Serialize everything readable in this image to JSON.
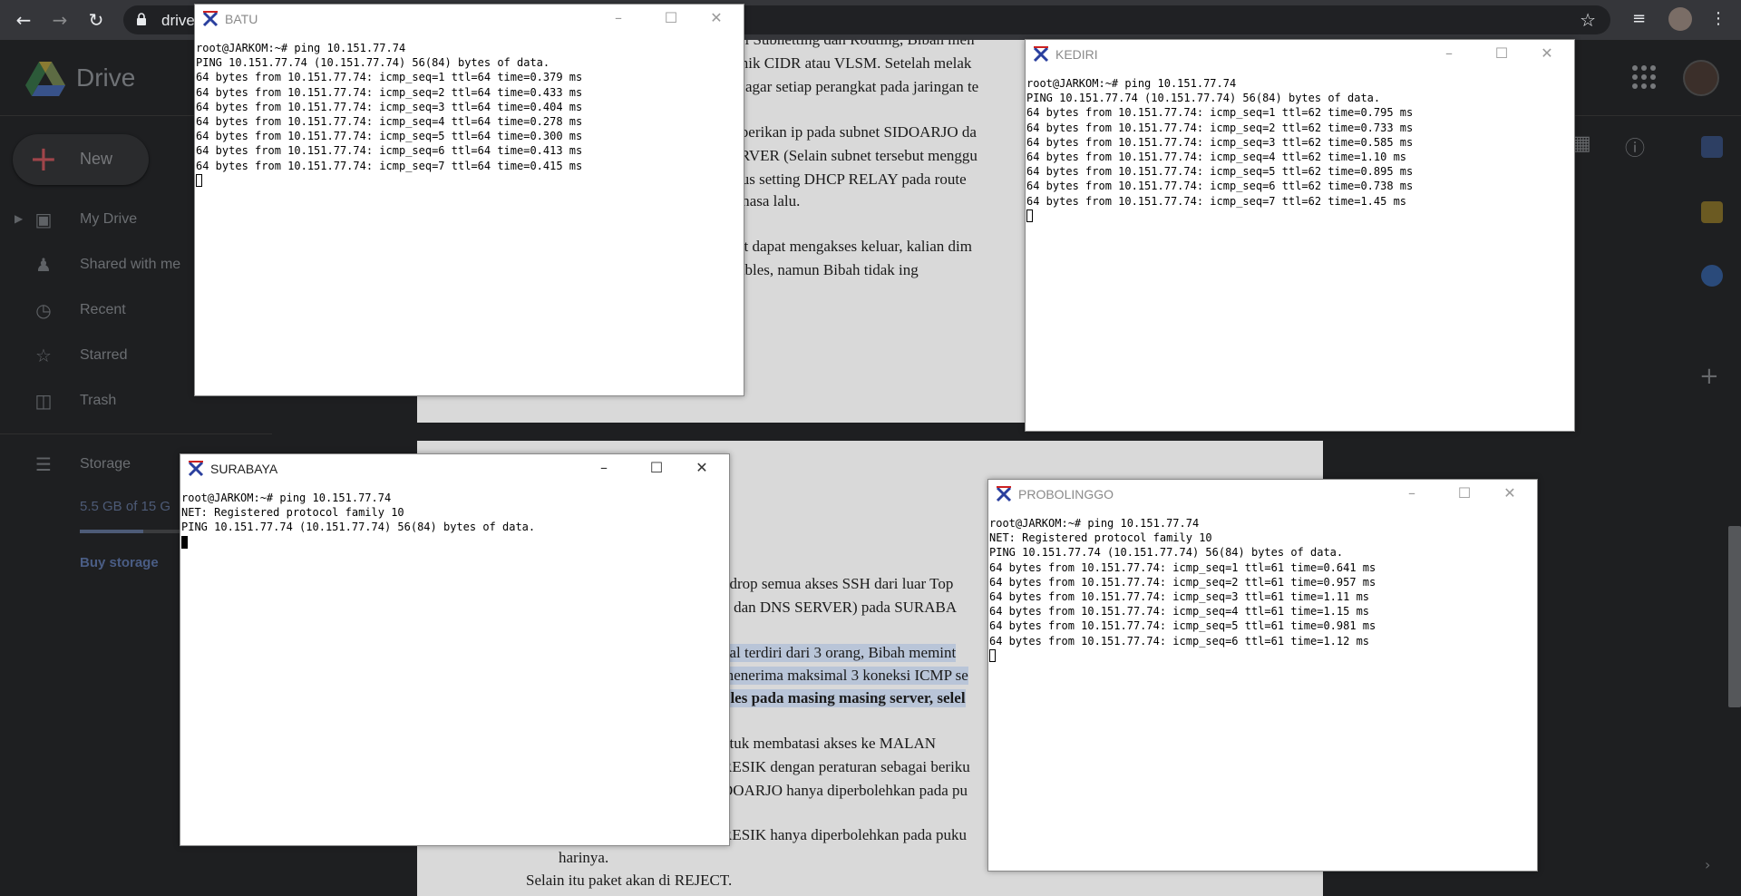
{
  "browser": {
    "url": "drive",
    "icons": {
      "back": "back-arrow-icon",
      "forward": "forward-arrow-icon",
      "reload": "reload-icon",
      "lock": "lock-icon",
      "bookmark": "star-icon",
      "reading_list": "reading-list-icon",
      "profile": "profile-icon",
      "menu": "kebab-menu-icon"
    }
  },
  "drive": {
    "brand": "Drive",
    "new_label": "New",
    "nav": [
      {
        "label": "My Drive",
        "icon": "my-drive-icon"
      },
      {
        "label": "Shared with me",
        "icon": "shared-icon"
      },
      {
        "label": "Recent",
        "icon": "clock-icon"
      },
      {
        "label": "Starred",
        "icon": "star-icon"
      },
      {
        "label": "Trash",
        "icon": "trash-icon"
      }
    ],
    "storage": {
      "label": "Storage",
      "usage_text": "5.5 GB of 15 G",
      "usage_fraction": 0.37,
      "buy_label": "Buy storage"
    },
    "colors": {
      "accent_dim": "#4d5b77",
      "highlight": "#b9c5d8"
    }
  },
  "document": {
    "page1": [
      "ajari Subnetting dan Routing, Bibah men",
      "teknik CIDR atau VLSM. Setelah melak",
      "ing agar setiap perangkat pada jaringan te",
      "emberikan ip pada subnet SIDOARJO da",
      "SERVER (Selain subnet tersebut menggu",
      "harus setting DHCP RELAY pada route",
      "di masa lalu.",
      "buat dapat mengakses keluar, kalian dim",
      "iptables,     namun     Bibah     tidak     ing"
    ],
    "page2": [
      "ndrop semua akses SSH dari luar Top",
      "P dan DNS SERVER) pada SURABA",
      "nal terdiri dari 3 orang, Bibah memint",
      "menerima maksimal 3 koneksi ICMP se",
      "bles pada masing masing server, selel",
      "ntuk   membatasi   akses   ke   MALAN",
      "RESIK dengan peraturan sebagai beriku",
      "DOARJO hanya diperbolehkan pada pu",
      "RESIK hanya diperbolehkan pada puku",
      "harinya.",
      "Selain itu paket akan di REJECT."
    ]
  },
  "terminals": {
    "batu": {
      "title": "BATU",
      "lines": [
        "root@JARKOM:~# ping 10.151.77.74",
        "PING 10.151.77.74 (10.151.77.74) 56(84) bytes of data.",
        "64 bytes from 10.151.77.74: icmp_seq=1 ttl=64 time=0.379 ms",
        "64 bytes from 10.151.77.74: icmp_seq=2 ttl=64 time=0.433 ms",
        "64 bytes from 10.151.77.74: icmp_seq=3 ttl=64 time=0.404 ms",
        "64 bytes from 10.151.77.74: icmp_seq=4 ttl=64 time=0.278 ms",
        "64 bytes from 10.151.77.74: icmp_seq=5 ttl=64 time=0.300 ms",
        "64 bytes from 10.151.77.74: icmp_seq=6 ttl=64 time=0.413 ms",
        "64 bytes from 10.151.77.74: icmp_seq=7 ttl=64 time=0.415 ms"
      ]
    },
    "kediri": {
      "title": "KEDIRI",
      "lines": [
        "root@JARKOM:~# ping 10.151.77.74",
        "PING 10.151.77.74 (10.151.77.74) 56(84) bytes of data.",
        "64 bytes from 10.151.77.74: icmp_seq=1 ttl=62 time=0.795 ms",
        "64 bytes from 10.151.77.74: icmp_seq=2 ttl=62 time=0.733 ms",
        "64 bytes from 10.151.77.74: icmp_seq=3 ttl=62 time=0.585 ms",
        "64 bytes from 10.151.77.74: icmp_seq=4 ttl=62 time=1.10 ms",
        "64 bytes from 10.151.77.74: icmp_seq=5 ttl=62 time=0.895 ms",
        "64 bytes from 10.151.77.74: icmp_seq=6 ttl=62 time=0.738 ms",
        "64 bytes from 10.151.77.74: icmp_seq=7 ttl=62 time=1.45 ms"
      ]
    },
    "surabaya": {
      "title": "SURABAYA",
      "lines": [
        "root@JARKOM:~# ping 10.151.77.74",
        "NET: Registered protocol family 10",
        "PING 10.151.77.74 (10.151.77.74) 56(84) bytes of data."
      ]
    },
    "probolinggo": {
      "title": "PROBOLINGGO",
      "lines": [
        "root@JARKOM:~# ping 10.151.77.74",
        "NET: Registered protocol family 10",
        "PING 10.151.77.74 (10.151.77.74) 56(84) bytes of data.",
        "64 bytes from 10.151.77.74: icmp_seq=1 ttl=61 time=0.641 ms",
        "64 bytes from 10.151.77.74: icmp_seq=2 ttl=61 time=0.957 ms",
        "64 bytes from 10.151.77.74: icmp_seq=3 ttl=61 time=1.11 ms",
        "64 bytes from 10.151.77.74: icmp_seq=4 ttl=61 time=1.15 ms",
        "64 bytes from 10.151.77.74: icmp_seq=5 ttl=61 time=0.981 ms",
        "64 bytes from 10.151.77.74: icmp_seq=6 ttl=61 time=1.12 ms"
      ]
    }
  }
}
